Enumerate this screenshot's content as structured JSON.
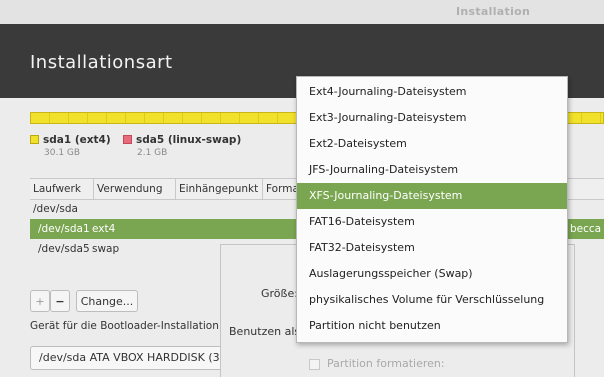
{
  "window": {
    "title": "Installation"
  },
  "header": {
    "title": "Installationsart"
  },
  "partitions_legend": [
    {
      "name": "sda1 (ext4)",
      "size": "30.1 GB",
      "color": "#f1e12a"
    },
    {
      "name": "sda5 (linux-swap)",
      "size": "2.1 GB",
      "color": "#e86a7b"
    }
  ],
  "table": {
    "columns": [
      "Laufwerk",
      "Verwendung",
      "Einhängepunkt",
      "Format"
    ],
    "rows": [
      {
        "device": "/dev/sda",
        "type": ""
      },
      {
        "device": "/dev/sda1",
        "type": "ext4",
        "tail": "becca ("
      },
      {
        "device": "/dev/sda5",
        "type": "swap"
      }
    ]
  },
  "buttons": {
    "add": "+",
    "remove": "−",
    "change": "Change..."
  },
  "bootloader": {
    "label": "Gerät für die Bootloader-Installation",
    "value": "/dev/sda   ATA VBOX HARDDISK (3"
  },
  "dialog": {
    "size_label": "Größe:",
    "use_as_label": "Benutzen als:",
    "format_label": "Partition formatieren:"
  },
  "dropdown": {
    "options": [
      "Ext4-Journaling-Dateisystem",
      "Ext3-Journaling-Dateisystem",
      "Ext2-Dateisystem",
      "JFS-Journaling-Dateisystem",
      "XFS-Journaling-Dateisystem",
      "FAT16-Dateisystem",
      "FAT32-Dateisystem",
      "Auslagerungsspeicher (Swap)",
      "physikalisches Volume für Verschlüsselung",
      "Partition nicht benutzen"
    ],
    "highlighted": "XFS-Journaling-Dateisystem"
  },
  "colors": {
    "accent": "#7ba651",
    "header_bg": "#3a3a3a",
    "ext4": "#f1e12a",
    "swap": "#e86a7b"
  }
}
